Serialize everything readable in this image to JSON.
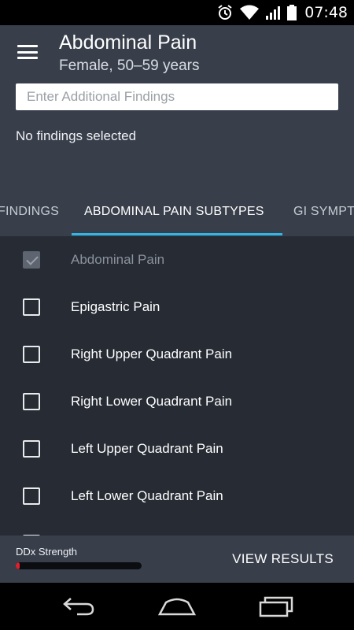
{
  "status_bar": {
    "time": "07:48",
    "icons": [
      "alarm-icon",
      "wifi-icon",
      "signal-icon",
      "battery-icon"
    ]
  },
  "header": {
    "menu_icon": "hamburger-menu-icon",
    "title": "Abdominal Pain",
    "subtitle": "Female, 50–59 years",
    "search_placeholder": "Enter Additional Findings",
    "search_value": "",
    "findings_status": "No findings selected"
  },
  "tabs": {
    "items": [
      {
        "label": "FINDINGS",
        "active": false
      },
      {
        "label": "ABDOMINAL PAIN SUBTYPES",
        "active": true
      },
      {
        "label": "GI SYMPT",
        "active": false
      }
    ],
    "accent_color": "#33b5e5"
  },
  "list": {
    "items": [
      {
        "label": "Abdominal Pain",
        "checked": true,
        "disabled": true
      },
      {
        "label": "Epigastric Pain",
        "checked": false,
        "disabled": false
      },
      {
        "label": "Right Upper Quadrant Pain",
        "checked": false,
        "disabled": false
      },
      {
        "label": "Right Lower Quadrant Pain",
        "checked": false,
        "disabled": false
      },
      {
        "label": "Left Upper Quadrant Pain",
        "checked": false,
        "disabled": false
      },
      {
        "label": "Left Lower Quadrant Pain",
        "checked": false,
        "disabled": false
      }
    ]
  },
  "footer": {
    "ddx_label": "DDx Strength",
    "ddx_strength": 0.03,
    "ddx_color": "#e0202c",
    "view_results_label": "VIEW RESULTS"
  },
  "nav_bar": {
    "icons": [
      "back-icon",
      "home-icon",
      "recents-icon"
    ]
  }
}
